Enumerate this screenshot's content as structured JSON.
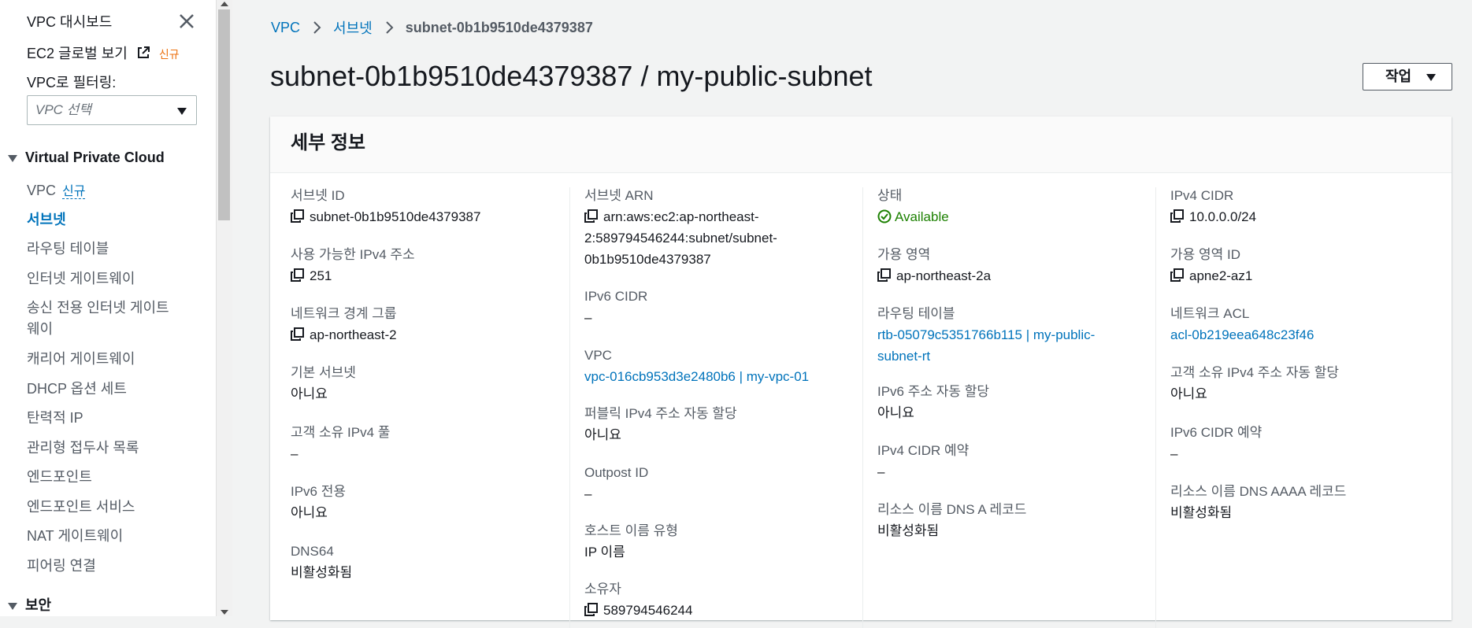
{
  "sidebar": {
    "dashboard": "VPC 대시보드",
    "ec2_global": "EC2 글로벌 보기",
    "ec2_global_new": "신규",
    "filter_label": "VPC로 필터링:",
    "filter_placeholder": "VPC 선택",
    "section_vpc": "Virtual Private Cloud",
    "vpc_item": "VPC",
    "vpc_item_new": "신규",
    "items": [
      "서브넷",
      "라우팅 테이블",
      "인터넷 게이트웨이",
      "송신 전용 인터넷 게이트",
      "웨이",
      "캐리어 게이트웨이",
      "DHCP 옵션 세트",
      "탄력적 IP",
      "관리형 접두사 목록",
      "엔드포인트",
      "엔드포인트 서비스",
      "NAT 게이트웨이",
      "피어링 연결"
    ],
    "section_security": "보안"
  },
  "breadcrumb": {
    "root": "VPC",
    "parent": "서브넷",
    "current": "subnet-0b1b9510de4379387"
  },
  "page": {
    "title": "subnet-0b1b9510de4379387 / my-public-subnet",
    "actions_label": "작업"
  },
  "details": {
    "header": "세부 정보",
    "col1": [
      {
        "label": "서브넷 ID",
        "value": "subnet-0b1b9510de4379387"
      },
      {
        "label": "사용 가능한 IPv4 주소",
        "value": "251"
      },
      {
        "label": "네트워크 경계 그룹",
        "value": "ap-northeast-2"
      },
      {
        "label": "기본 서브넷",
        "value": "아니요"
      },
      {
        "label": "고객 소유 IPv4 풀",
        "value": "–"
      },
      {
        "label": "IPv6 전용",
        "value": "아니요"
      },
      {
        "label": "DNS64",
        "value": "비활성화됨"
      }
    ],
    "col2": [
      {
        "label": "서브넷 ARN",
        "value_lines": [
          "arn:aws:ec2:ap-northeast-",
          "2:589794546244:subnet/subnet-",
          "0b1b9510de4379387"
        ]
      },
      {
        "label": "IPv6 CIDR",
        "value": "–"
      },
      {
        "label": "VPC",
        "value": "vpc-016cb953d3e2480b6 | my-vpc-01"
      },
      {
        "label": "퍼블릭 IPv4 주소 자동 할당",
        "value": "아니요"
      },
      {
        "label": "Outpost ID",
        "value": "–"
      },
      {
        "label": "호스트 이름 유형",
        "value": "IP 이름"
      },
      {
        "label": "소유자",
        "value": "589794546244"
      }
    ],
    "col3": [
      {
        "label": "상태",
        "value": "Available"
      },
      {
        "label": "가용 영역",
        "value": "ap-northeast-2a"
      },
      {
        "label": "라우팅 테이블",
        "value_lines": [
          "rtb-05079c5351766b115 | my-public-",
          "subnet-rt"
        ]
      },
      {
        "label": "IPv6 주소 자동 할당",
        "value": "아니요"
      },
      {
        "label": "IPv4 CIDR 예약",
        "value": "–"
      },
      {
        "label": "리소스 이름 DNS A 레코드",
        "value": "비활성화됨"
      }
    ],
    "col4": [
      {
        "label": "IPv4 CIDR",
        "value": "10.0.0.0/24"
      },
      {
        "label": "가용 영역 ID",
        "value": "apne2-az1"
      },
      {
        "label": "네트워크 ACL",
        "value": "acl-0b219eea648c23f46"
      },
      {
        "label": "고객 소유 IPv4 주소 자동 할당",
        "value": "아니요"
      },
      {
        "label": "IPv6 CIDR 예약",
        "value": "–"
      },
      {
        "label": "리소스 이름 DNS AAAA 레코드",
        "value": "비활성화됨"
      }
    ]
  },
  "colors": {
    "link": "#0073bb",
    "success": "#1d8102",
    "new_badge": "#ec7211"
  }
}
